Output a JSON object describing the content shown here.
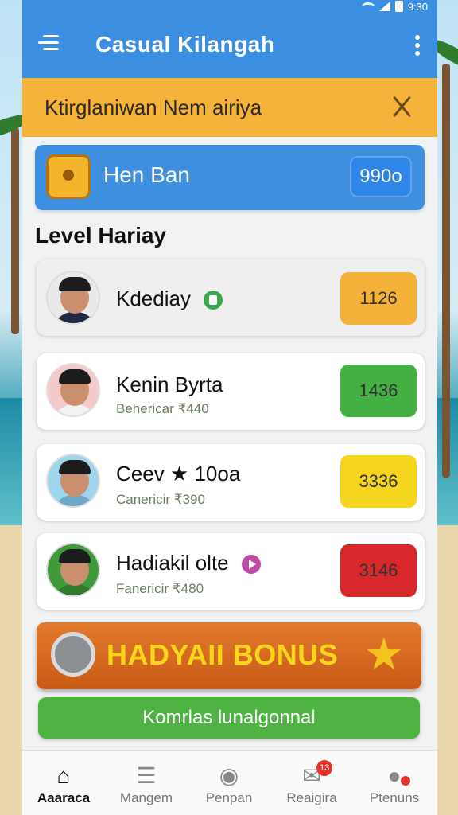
{
  "statusbar": {
    "time": "9:30"
  },
  "appbar": {
    "title": "Casual Kilangah"
  },
  "banner": {
    "text": "Ktirglaniwan Nem airiya"
  },
  "hero": {
    "title": "Hen Ban",
    "badge": "990o"
  },
  "section": {
    "title": "Level Hariay"
  },
  "players": [
    {
      "name": "Kdediay",
      "sub": "",
      "score": "1126",
      "score_color": "#f4b23b",
      "badge": "green-circle-icon"
    },
    {
      "name": "Kenin Byrta",
      "sub": "Behericar ₹440",
      "score": "1436",
      "score_color": "#44b044",
      "badge": ""
    },
    {
      "name": "Ceev ★ 10oa",
      "sub": "Canericir ₹390",
      "score": "3336",
      "score_color": "#f6d51f",
      "badge": ""
    },
    {
      "name": "Hadiakil olte",
      "sub": "Fanericir ₹480",
      "score": "3146",
      "score_color": "#d8282b",
      "badge": "play-icon"
    }
  ],
  "bonus": {
    "label": "HADYAII BONUS"
  },
  "action": {
    "label": "Komrlas lunalgonnal"
  },
  "nav": [
    {
      "label": "Aaaraca",
      "icon": "home-icon",
      "active": true
    },
    {
      "label": "Mangem",
      "icon": "clipboard-icon"
    },
    {
      "label": "Penpan",
      "icon": "badge-icon"
    },
    {
      "label": "Reaigira",
      "icon": "message-icon",
      "count": "13"
    },
    {
      "label": "Ptenuns",
      "icon": "profile-icon"
    }
  ]
}
